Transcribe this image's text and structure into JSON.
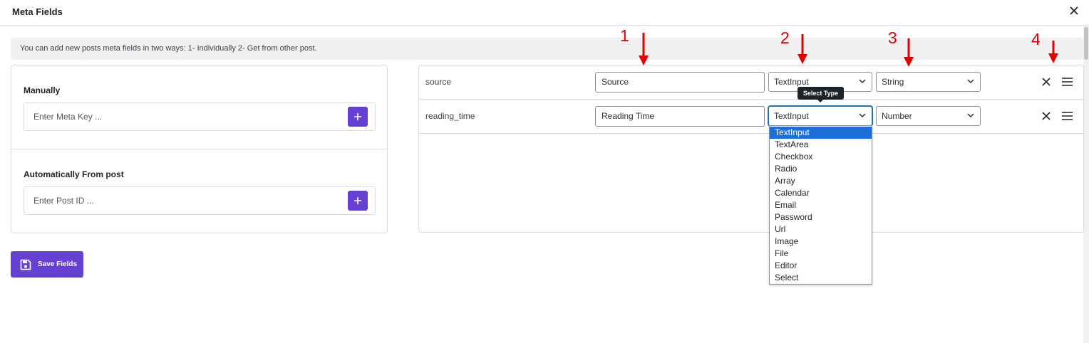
{
  "header": {
    "title": "Meta Fields"
  },
  "notice": {
    "text": "You can add new posts meta fields in two ways: 1- Individually 2- Get from other post."
  },
  "manual": {
    "label": "Manually",
    "placeholder": "Enter Meta Key ..."
  },
  "automatic": {
    "label": "Automatically From post",
    "placeholder": "Enter Post ID ..."
  },
  "save_button": {
    "label": "Save Fields"
  },
  "fields": [
    {
      "key": "source",
      "title": "Source",
      "type": "TextInput",
      "value_type": "String"
    },
    {
      "key": "reading_time",
      "title": "Reading Time",
      "type": "TextInput",
      "value_type": "Number"
    }
  ],
  "tooltip": {
    "text": "Select Type"
  },
  "type_options": [
    "TextInput",
    "TextArea",
    "Checkbox",
    "Radio",
    "Array",
    "Calendar",
    "Email",
    "Password",
    "Url",
    "Image",
    "File",
    "Editor",
    "Select"
  ],
  "selected_type_option": "TextInput",
  "annotations": [
    "1",
    "2",
    "3",
    "4"
  ],
  "colors": {
    "accent": "#6540d2",
    "annotation": "#e00000",
    "dropdown_highlight": "#1e6fd9"
  },
  "icons": [
    "close-icon",
    "plus-icon",
    "save-icon",
    "chevron-down-icon",
    "remove-icon",
    "drag-handle-icon",
    "arrow-down-icon"
  ]
}
